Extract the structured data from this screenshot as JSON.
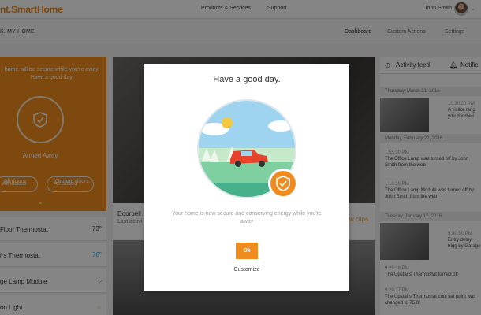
{
  "header": {
    "logo": "nt.SmartHome",
    "nav": [
      "Products & Services",
      "Support"
    ],
    "user_name": "John Smith",
    "caret": "⌄"
  },
  "subnav": {
    "home_title": "K. MY HOME",
    "tabs": [
      "Dashboard",
      "Custom Actions",
      "Settings"
    ],
    "active_tab": "Dashboard"
  },
  "security": {
    "message": "home will be secure while you're away. Have a good day.",
    "state": "Armed Away",
    "doors_label": "All doors",
    "garage_label": "Garage doors",
    "doors_status": "All locked",
    "garage_status": "All closed",
    "chevron": "⌄"
  },
  "devices": [
    {
      "name": "Floor Thermostat",
      "value": "73°"
    },
    {
      "name": "irs Thermostat",
      "value": "76°"
    },
    {
      "name": "ge Lamp Module",
      "value": "○"
    },
    {
      "name": "on Light",
      "value": "☼"
    }
  ],
  "camera": {
    "title": "Doorbell",
    "subtitle": "Last activi",
    "link": "ew clips"
  },
  "feed": {
    "tabs": [
      "Activity feed",
      "Notific"
    ],
    "groups": [
      {
        "date": "Thursday, March 31, 2016",
        "items": [
          {
            "time": "10:30:20 PM",
            "text": "A visitor rang you doorbell"
          }
        ]
      },
      {
        "date": "Monday, February 22, 2016",
        "items": [
          {
            "time": "1:55:30 PM",
            "text": "The Office Lamp was turned off by John Smith from the web"
          },
          {
            "time": "1:16:16 PM",
            "text": "The Office Lamp Module was turned off by John Smith from the web"
          }
        ]
      },
      {
        "date": "Tuesday, January 17, 2016",
        "items": [
          {
            "time": "9:30:50 PM",
            "text": "Entry delay trigg by Garage"
          },
          {
            "time": "9:29:18 PM",
            "text": "The Upstairs Thermostat turned off"
          },
          {
            "time": "9:29:17 PM",
            "text": "The Upstairs Thermostat cool set point was changed to 75.0°"
          }
        ]
      }
    ]
  },
  "modal": {
    "title": "Have a good day.",
    "message": "Your home is now secure and conserving energy while you're away",
    "ok_label": "Ok",
    "customize_label": "Customize"
  },
  "colors": {
    "accent": "#f08c1e",
    "sky": "#9ed4f0",
    "grass": "#7fd0a0",
    "car": "#e8432a"
  }
}
